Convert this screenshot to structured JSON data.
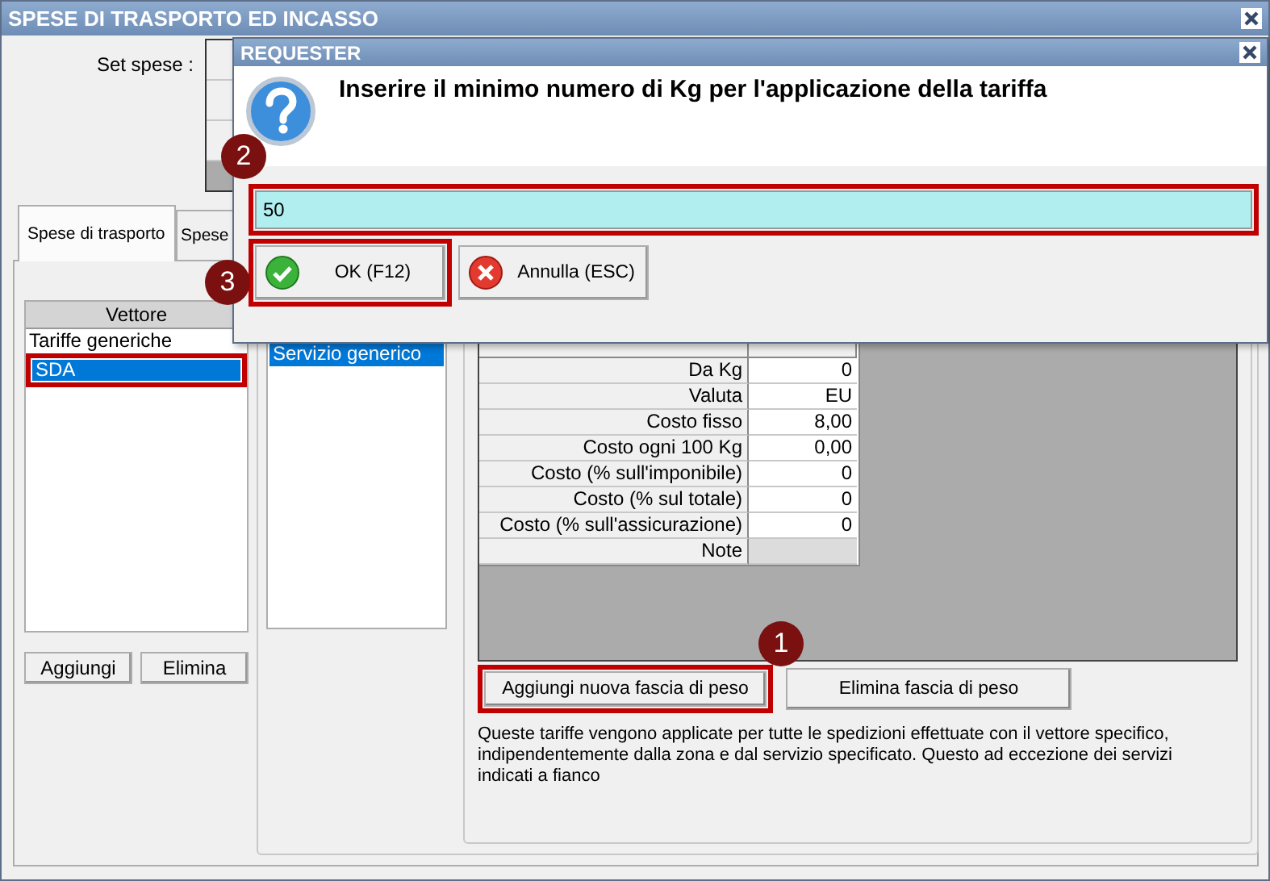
{
  "window": {
    "title": "SPESE DI TRASPORTO ED INCASSO"
  },
  "set_spese": {
    "label": "Set spese :"
  },
  "tabs": [
    {
      "label": "Spese di trasporto",
      "selected": true
    },
    {
      "label": "Spese",
      "selected": false
    }
  ],
  "vettori": {
    "header": "Vettore",
    "items": [
      {
        "label": "Tariffe generiche",
        "selected": false,
        "highlighted": false
      },
      {
        "label": "SDA",
        "selected": true,
        "highlighted": true
      }
    ],
    "buttons": [
      "Aggiungi",
      "Elimina"
    ]
  },
  "servizi": {
    "items": [
      {
        "label": "Servizio generico",
        "selected": true
      }
    ]
  },
  "tariffa": {
    "rows": [
      {
        "label": "Da Kg",
        "value": "0",
        "editable": true
      },
      {
        "label": "Valuta",
        "value": "EU",
        "editable": true
      },
      {
        "label": "Costo fisso",
        "value": "8,00",
        "editable": true
      },
      {
        "label": "Costo ogni 100 Kg",
        "value": "0,00",
        "editable": true
      },
      {
        "label": "Costo (% sull'imponibile)",
        "value": "0",
        "editable": true
      },
      {
        "label": "Costo (% sul totale)",
        "value": "0",
        "editable": true
      },
      {
        "label": "Costo (% sull'assicurazione)",
        "value": "0",
        "editable": true
      },
      {
        "label": "Note",
        "editable": false
      }
    ]
  },
  "fascia_buttons": [
    {
      "label": "Aggiungi nuova fascia di peso",
      "highlighted": true,
      "badge": "1"
    },
    {
      "label": "Elimina fascia di peso",
      "highlighted": false
    }
  ],
  "note": "Queste tariffe vengono applicate per tutte le spedizioni effettuate con il vettore specifico, indipendentemente dalla zona e dal servizio specificato. Questo ad eccezione dei servizi indicati a fianco",
  "dialog": {
    "title": "REQUESTER",
    "message": "Inserire il minimo numero di Kg per l'applicazione della tariffa",
    "input": {
      "value": "50",
      "highlighted": true,
      "badge": "2"
    },
    "buttons": [
      {
        "label": "OK (F12)",
        "kind": "ok",
        "highlighted": true,
        "badge": "3"
      },
      {
        "label": "Annulla (ESC)",
        "kind": "cancel",
        "highlighted": false
      }
    ]
  }
}
